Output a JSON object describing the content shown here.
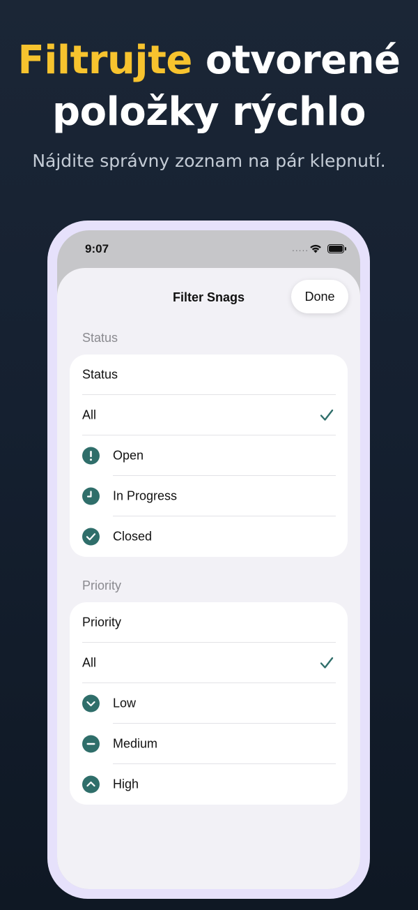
{
  "promo": {
    "headline_accent": "Filtrujte",
    "headline_rest_line1": " otvorené",
    "headline_line2": "položky rýchlo",
    "subtitle": "Nájdite správny zoznam na pár klepnutí."
  },
  "status_bar": {
    "time": "9:07",
    "signal_dots": "....."
  },
  "sheet": {
    "title": "Filter Snags",
    "done_label": "Done"
  },
  "status_section": {
    "header": "Status",
    "picker_label": "Status",
    "options": [
      {
        "label": "All",
        "icon": "none",
        "selected": true
      },
      {
        "label": "Open",
        "icon": "exclamation-circle-icon"
      },
      {
        "label": "In Progress",
        "icon": "clock-circle-icon"
      },
      {
        "label": "Closed",
        "icon": "checkmark-circle-icon"
      }
    ]
  },
  "priority_section": {
    "header": "Priority",
    "picker_label": "Priority",
    "options": [
      {
        "label": "All",
        "icon": "none",
        "selected": true
      },
      {
        "label": "Low",
        "icon": "chevron-down-circle-icon"
      },
      {
        "label": "Medium",
        "icon": "minus-circle-icon"
      },
      {
        "label": "High",
        "icon": "chevron-up-circle-icon"
      }
    ]
  },
  "colors": {
    "accent_yellow": "#f7c32e",
    "icon_teal": "#2f6e6a",
    "background": "#172232",
    "phone_frame": "#e6e1fb"
  }
}
